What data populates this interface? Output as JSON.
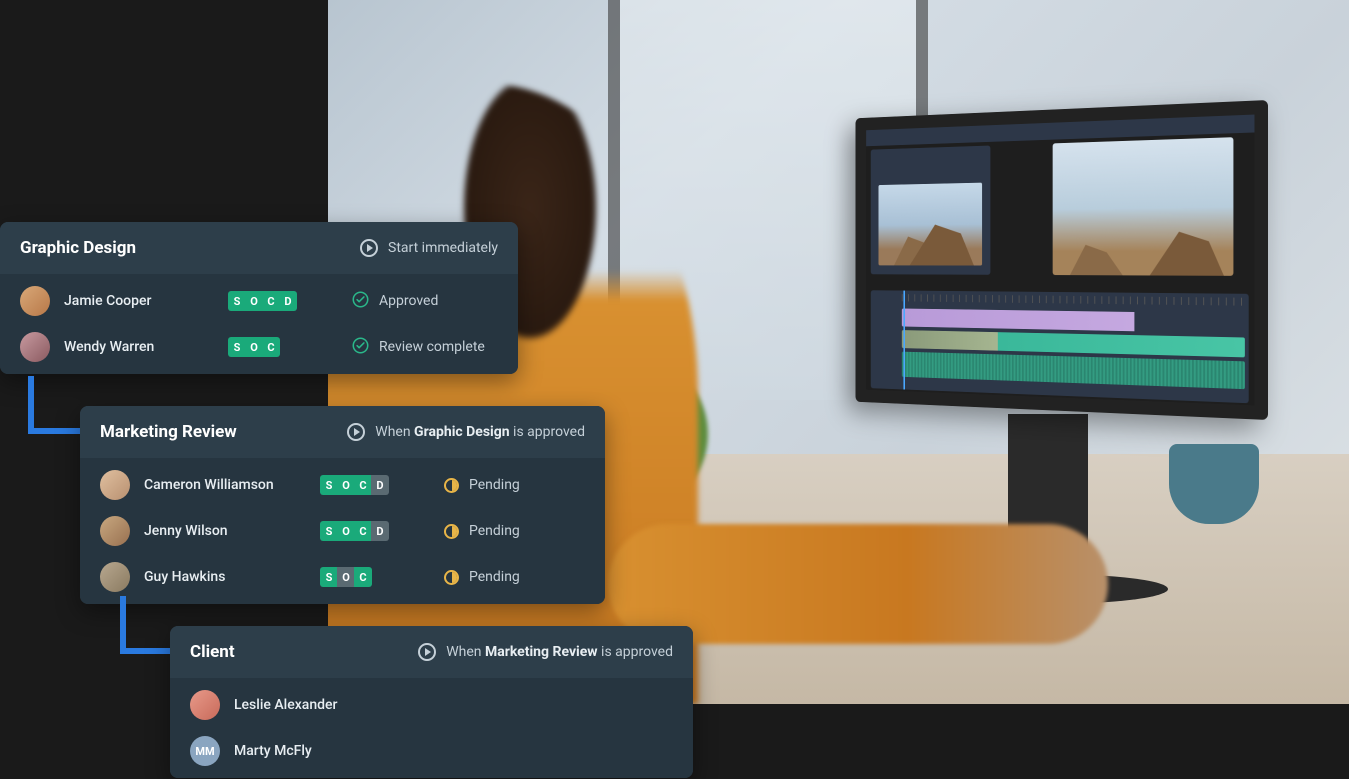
{
  "cards": [
    {
      "title": "Graphic Design",
      "trigger_prefix": "",
      "trigger_bold": "",
      "trigger_suffix": "Start immediately",
      "rows": [
        {
          "name": "Jamie Cooper",
          "avatar_bg": "linear-gradient(135deg,#d8a878,#b87848)",
          "perms": [
            "S",
            "O",
            "C",
            "D"
          ],
          "perms_on": [
            true,
            true,
            true,
            true
          ],
          "status": "Approved",
          "status_type": "check"
        },
        {
          "name": "Wendy Warren",
          "avatar_bg": "linear-gradient(135deg,#c89aa0,#8a5a60)",
          "perms": [
            "S",
            "O",
            "C"
          ],
          "perms_on": [
            true,
            true,
            true
          ],
          "status": "Review complete",
          "status_type": "check"
        }
      ]
    },
    {
      "title": "Marketing Review",
      "trigger_prefix": "When ",
      "trigger_bold": "Graphic Design",
      "trigger_suffix": " is approved",
      "rows": [
        {
          "name": "Cameron Williamson",
          "avatar_bg": "linear-gradient(135deg,#e0c0a0,#b89070)",
          "perms": [
            "S",
            "O",
            "C",
            "D"
          ],
          "perms_on": [
            true,
            true,
            true,
            false
          ],
          "status": "Pending",
          "status_type": "pending"
        },
        {
          "name": "Jenny Wilson",
          "avatar_bg": "linear-gradient(135deg,#c8a880,#987050)",
          "perms": [
            "S",
            "O",
            "C",
            "D"
          ],
          "perms_on": [
            true,
            true,
            true,
            false
          ],
          "status": "Pending",
          "status_type": "pending"
        },
        {
          "name": "Guy Hawkins",
          "avatar_bg": "linear-gradient(135deg,#b8a890,#8a7a60)",
          "perms": [
            "S",
            "O",
            "C"
          ],
          "perms_on": [
            true,
            false,
            true
          ],
          "status": "Pending",
          "status_type": "pending"
        }
      ]
    },
    {
      "title": "Client",
      "trigger_prefix": "When ",
      "trigger_bold": "Marketing Review",
      "trigger_suffix": " is approved",
      "rows": [
        {
          "name": "Leslie Alexander",
          "avatar_bg": "linear-gradient(135deg,#e89a8a,#c86a5a)",
          "initials": ""
        },
        {
          "name": "Marty McFly",
          "avatar_bg": "#8aa5c0",
          "initials": "MM"
        }
      ]
    }
  ]
}
